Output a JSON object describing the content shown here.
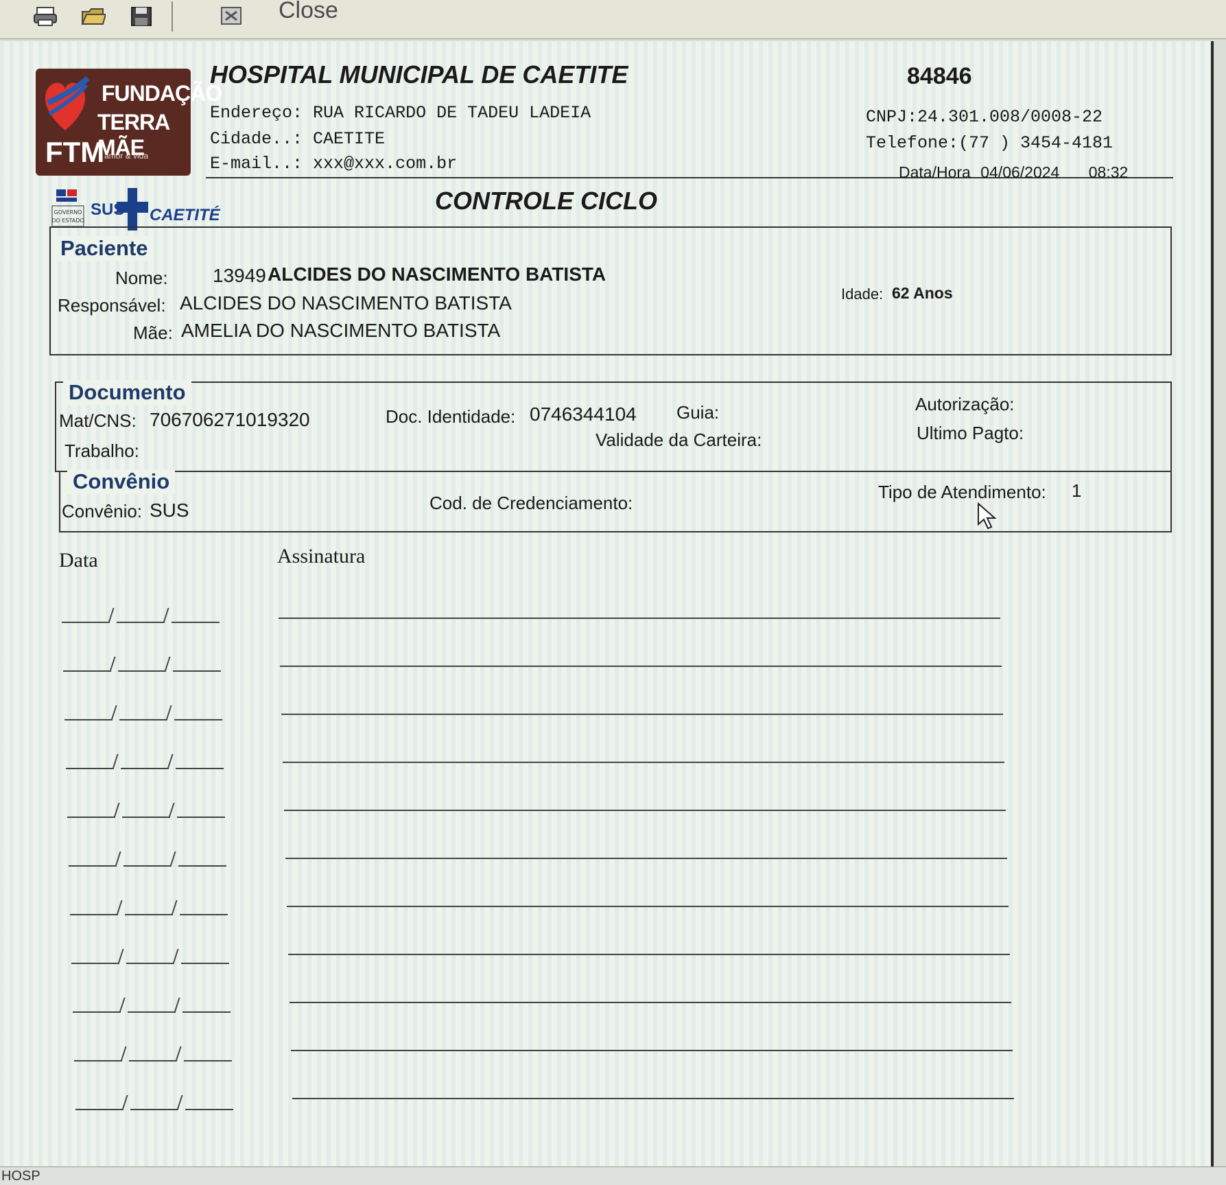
{
  "toolbar": {
    "close_label": "Close"
  },
  "logo": {
    "line1": "FUNDAÇÃO",
    "line2": "TERRA MÃE",
    "abbr": "FTM",
    "sub": "amor & vida"
  },
  "gov_logos": {
    "sus": "SUS",
    "caetite": "CAETITÉ"
  },
  "header": {
    "hospital_name": "HOSPITAL MUNICIPAL DE CAETITE",
    "address_label": "Endereço:",
    "address_value": "RUA RICARDO DE TADEU LADEIA",
    "city_label": "Cidade..:",
    "city_value": "CAETITE",
    "email_label": "E-mail..:",
    "email_value": "xxx@xxx.com.br",
    "code": "84846",
    "cnpj": "CNPJ:24.301.008/0008-22",
    "telefone": "Telefone:(77 ) 3454-4181",
    "datahora_label": "Data/Hora",
    "date": "04/06/2024",
    "time": "08:32"
  },
  "title": "CONTROLE CICLO",
  "paciente": {
    "legend": "Paciente",
    "nome_label": "Nome:",
    "nome_id": "13949",
    "nome_value": "ALCIDES DO NASCIMENTO BATISTA",
    "responsavel_label": "Responsável:",
    "responsavel_value": "ALCIDES DO NASCIMENTO BATISTA",
    "mae_label": "Mãe:",
    "mae_value": "AMELIA DO NASCIMENTO BATISTA",
    "idade_label": "Idade:",
    "idade_value": "62 Anos"
  },
  "documento": {
    "legend": "Documento",
    "mat_label": "Mat/CNS:",
    "mat_value": "706706271019320",
    "doc_label": "Doc. Identidade:",
    "doc_value": "0746344104",
    "guia_label": "Guia:",
    "autorizacao_label": "Autorização:",
    "validade_label": "Validade da Carteira:",
    "ultimo_label": "Ultimo Pagto:",
    "trabalho_label": "Trabalho:"
  },
  "convenio": {
    "legend": "Convênio",
    "convenio_label": "Convênio:",
    "convenio_value": "SUS",
    "cod_label": "Cod. de Credenciamento:",
    "tipo_label": "Tipo de Atendimento:",
    "tipo_value": "1"
  },
  "signature_table": {
    "data_header": "Data",
    "assinatura_header": "Assinatura",
    "rows": 11
  },
  "statusbar": {
    "text": "HOSP"
  }
}
